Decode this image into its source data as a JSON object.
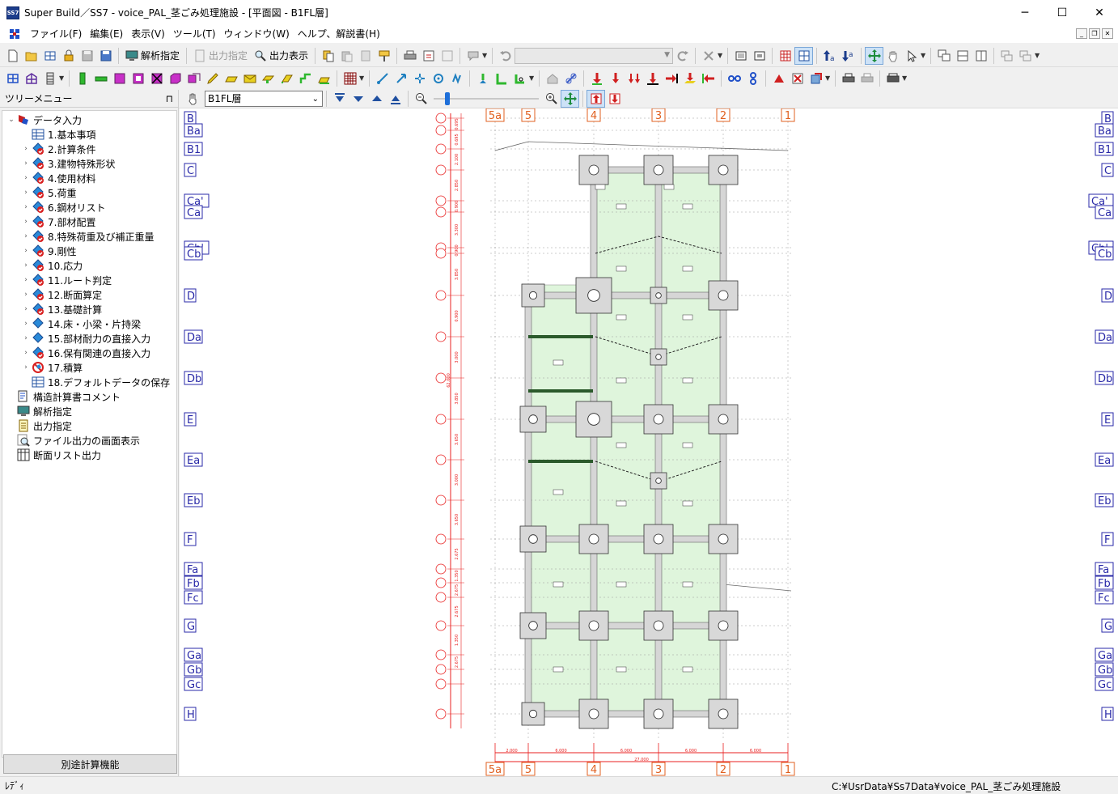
{
  "window": {
    "title": "Super Build／SS7 - voice_PAL_茎ごみ処理施設 - [平面図 - B1FL層]",
    "app_icon_text": "SS7",
    "minimize": "─",
    "maximize": "☐",
    "close": "✕"
  },
  "menu": {
    "items": [
      "ファイル(F)",
      "編集(E)",
      "表示(V)",
      "ツール(T)",
      "ウィンドウ(W)",
      "ヘルプ、解説書(H)"
    ],
    "mdi_controls": [
      "_",
      "❐",
      "✕"
    ]
  },
  "toolbar1": {
    "analysis_label": "解析指定",
    "output_spec_label": "出力指定",
    "output_display_label": "出力表示"
  },
  "toolbar3": {
    "floor": "B1FL層"
  },
  "sidebar": {
    "header": "ツリーメニュー",
    "pin": "⊓",
    "tree": [
      {
        "label": "データ入力",
        "level": 0,
        "expanded": true,
        "icon": "data-input-icon"
      },
      {
        "label": "1.基本事項",
        "level": 1,
        "icon": "sheet-icon"
      },
      {
        "label": "2.計算条件",
        "level": 1,
        "icon": "check-diamond-icon"
      },
      {
        "label": "3.建物特殊形状",
        "level": 1,
        "icon": "check-diamond-icon"
      },
      {
        "label": "4.使用材料",
        "level": 1,
        "icon": "check-diamond-icon"
      },
      {
        "label": "5.荷重",
        "level": 1,
        "icon": "check-diamond-icon"
      },
      {
        "label": "6.鋼材リスト",
        "level": 1,
        "icon": "check-diamond-icon"
      },
      {
        "label": "7.部材配置",
        "level": 1,
        "icon": "check-diamond-icon"
      },
      {
        "label": "8.特殊荷重及び補正重量",
        "level": 1,
        "icon": "check-diamond-icon"
      },
      {
        "label": "9.剛性",
        "level": 1,
        "icon": "check-diamond-icon"
      },
      {
        "label": "10.応力",
        "level": 1,
        "icon": "check-diamond-icon"
      },
      {
        "label": "11.ルート判定",
        "level": 1,
        "icon": "check-diamond-icon"
      },
      {
        "label": "12.断面算定",
        "level": 1,
        "icon": "check-diamond-icon"
      },
      {
        "label": "13.基礎計算",
        "level": 1,
        "icon": "check-diamond-icon"
      },
      {
        "label": "14.床・小梁・片持梁",
        "level": 1,
        "icon": "diamond-icon"
      },
      {
        "label": "15.部材耐力の直接入力",
        "level": 1,
        "icon": "diamond-icon"
      },
      {
        "label": "16.保有関連の直接入力",
        "level": 1,
        "icon": "check-diamond-icon"
      },
      {
        "label": "17.積算",
        "level": 1,
        "icon": "prohibited-icon"
      },
      {
        "label": "18.デフォルトデータの保存",
        "level": 1,
        "icon": "sheet-icon"
      },
      {
        "label": "構造計算書コメント",
        "level": 0,
        "icon": "comment-icon"
      },
      {
        "label": "解析指定",
        "level": 0,
        "icon": "monitor-icon"
      },
      {
        "label": "出力指定",
        "level": 0,
        "icon": "document-icon"
      },
      {
        "label": "ファイル出力の画面表示",
        "level": 0,
        "icon": "magnifier-icon"
      },
      {
        "label": "断面リスト出力",
        "level": 0,
        "icon": "list-icon"
      }
    ],
    "bottom_button": "別途計算機能"
  },
  "plan": {
    "x_axes": [
      "5a",
      "5",
      "4",
      "3",
      "2",
      "1"
    ],
    "y_axes": [
      "B",
      "Ba",
      "B1",
      "C",
      "Ca'",
      "Ca",
      "Cb'",
      "Cb",
      "D",
      "Da",
      "Db",
      "E",
      "Ea",
      "Eb",
      "F",
      "Fa",
      "Fb",
      "Fc",
      "G",
      "Ga",
      "Gb",
      "Gc",
      "H"
    ],
    "left_dims": [
      "0.695",
      "0.695",
      "2.100",
      "2.850",
      "0.900",
      "3.300",
      "0.900",
      "3.850",
      "0.900",
      "3.000",
      "3.850",
      "3.650",
      "3.000",
      "3.650",
      "2.675",
      "1.350",
      "2.675",
      "2.675",
      "1.350",
      "2.675"
    ],
    "total_dim": "62.000",
    "bottom_dims": [
      "2.000",
      "6.000",
      "6.000",
      "6.000",
      "6.000"
    ],
    "bottom_total": "27.000",
    "colors": {
      "axis": "#e8a0a0",
      "grid_label": "#2a2aa8",
      "red_dim": "#e82020",
      "slab": "#dff5dc",
      "beam": "#d6d6d6",
      "column": "#d8d8d8",
      "wall": "#2b5a2b"
    }
  },
  "status": {
    "left": "ﾚﾃﾞｨ",
    "right": "C:¥UsrData¥Ss7Data¥voice_PAL_茎ごみ処理施設"
  }
}
